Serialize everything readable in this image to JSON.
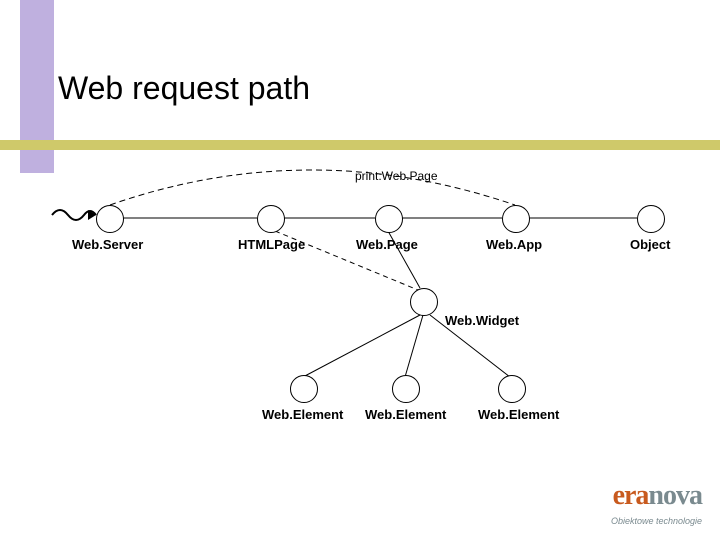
{
  "title": "Web request path",
  "diagram": {
    "message": "print:Web.Page",
    "nodes": {
      "webserver": {
        "label": "Web.Server"
      },
      "htmlpage": {
        "label": "HTMLPage"
      },
      "webpage": {
        "label": "Web.Page"
      },
      "webapp": {
        "label": "Web.App"
      },
      "object": {
        "label": "Object"
      },
      "webwidget": {
        "label": "Web.Widget"
      },
      "webelem1": {
        "label": "Web.Element"
      },
      "webelem2": {
        "label": "Web.Element"
      },
      "webelem3": {
        "label": "Web.Element"
      }
    }
  },
  "logo": {
    "part1": "era",
    "part2": "nova",
    "tagline": "Obiektowe technologie"
  }
}
